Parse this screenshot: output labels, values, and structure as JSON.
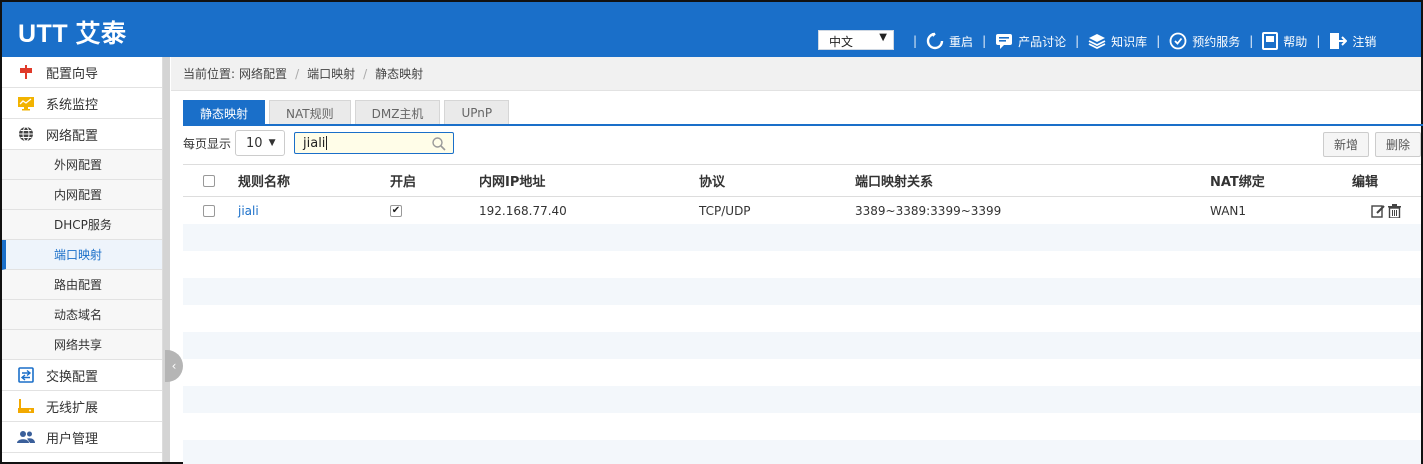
{
  "header": {
    "logo": "UTT 艾泰",
    "language": "中文",
    "nav": [
      {
        "label": "重启",
        "icon": "restart-icon"
      },
      {
        "label": "产品讨论",
        "icon": "chat-icon"
      },
      {
        "label": "知识库",
        "icon": "layers-icon"
      },
      {
        "label": "预约服务",
        "icon": "service-icon"
      },
      {
        "label": "帮助",
        "icon": "book-icon"
      },
      {
        "label": "注销",
        "icon": "logout-icon"
      }
    ]
  },
  "sidebar": {
    "items": [
      {
        "label": "配置向导",
        "icon": "flag-icon"
      },
      {
        "label": "系统监控",
        "icon": "monitor-icon"
      },
      {
        "label": "网络配置",
        "icon": "globe-icon"
      }
    ],
    "sub_items": [
      {
        "label": "外网配置"
      },
      {
        "label": "内网配置"
      },
      {
        "label": "DHCP服务"
      },
      {
        "label": "端口映射"
      },
      {
        "label": "路由配置"
      },
      {
        "label": "动态域名"
      },
      {
        "label": "网络共享"
      }
    ],
    "items_after": [
      {
        "label": "交换配置",
        "icon": "switch-icon"
      },
      {
        "label": "无线扩展",
        "icon": "router-icon"
      },
      {
        "label": "用户管理",
        "icon": "users-icon"
      }
    ]
  },
  "breadcrumb": {
    "prefix": "当前位置:",
    "items": [
      "网络配置",
      "端口映射",
      "静态映射"
    ]
  },
  "tabs": [
    "静态映射",
    "NAT规则",
    "DMZ主机",
    "UPnP"
  ],
  "toolbar": {
    "page_size_label": "每页显示",
    "page_size": "10",
    "search_value": "jiali",
    "add_label": "新增",
    "delete_label": "删除"
  },
  "table": {
    "columns": [
      "规则名称",
      "开启",
      "内网IP地址",
      "协议",
      "端口映射关系",
      "NAT绑定",
      "编辑"
    ],
    "rows": [
      {
        "name": "jiali",
        "enabled": true,
        "ip": "192.168.77.40",
        "protocol": "TCP/UDP",
        "mapping": "3389~3389:3399~3399",
        "nat": "WAN1"
      }
    ]
  },
  "colors": {
    "accent": "#1a6fc9",
    "row_alt": "#f3f7fb"
  }
}
